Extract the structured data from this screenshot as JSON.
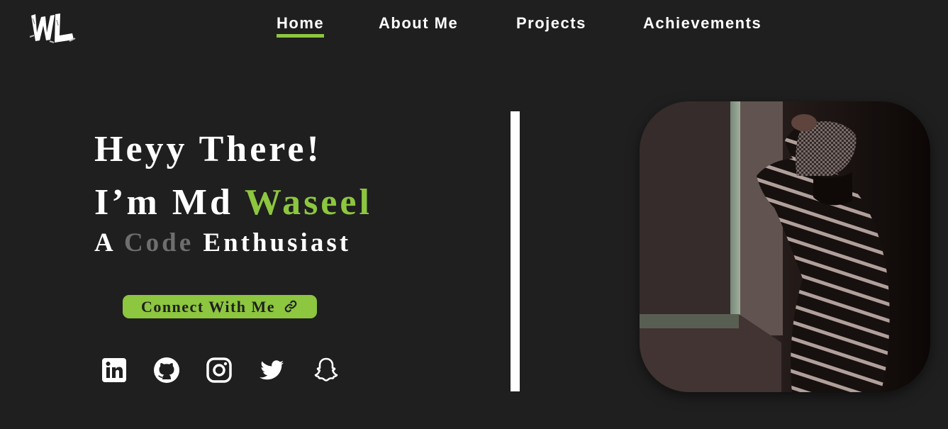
{
  "logo": {
    "text": "WL",
    "icon": "brush-monogram-logo"
  },
  "nav": {
    "items": [
      {
        "label": "Home",
        "active": true
      },
      {
        "label": "About Me",
        "active": false
      },
      {
        "label": "Projects",
        "active": false
      },
      {
        "label": "Achievements",
        "active": false
      }
    ]
  },
  "hero": {
    "greeting": "Heyy There!",
    "name_prefix": "I’m Md ",
    "name_accent": "Waseel",
    "role_prefix": "A ",
    "role_dim": "Code",
    "role_suffix": " Enthusiast",
    "cta_label": "Connect With Me",
    "cta_icon": "link-icon"
  },
  "social": [
    {
      "name": "linkedin-icon"
    },
    {
      "name": "github-icon"
    },
    {
      "name": "instagram-icon"
    },
    {
      "name": "twitter-icon"
    },
    {
      "name": "snapchat-icon"
    }
  ],
  "colors": {
    "background": "#1f1f1f",
    "accent": "#8dc63f",
    "text": "#ffffff",
    "dim": "#6e6e6e"
  },
  "photo": {
    "subject": "profile-photo"
  }
}
